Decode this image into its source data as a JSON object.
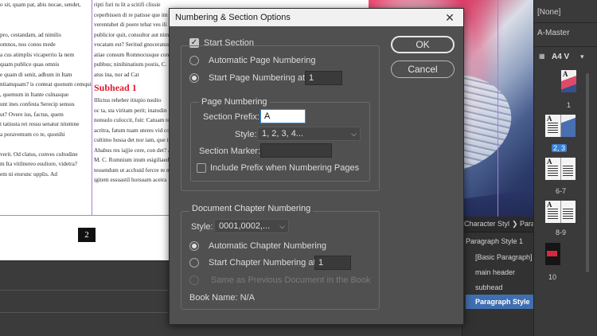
{
  "document": {
    "column1_lines": [
      "o sit, quam pat, abis nocae, sendet,",
      "",
      "",
      "pro, cestandam, ad nimilis",
      "omnos, nos conos mede",
      "a cus atimplis vicaperrio la nem",
      "quam publice quas omnis",
      "e quam di senit, adhum in Itam",
      "ntiamquam? is conteat quonum cemquiu",
      ", quemum in Itante culnasque",
      "unt ines confesta Serecip sensus",
      "ut? Overe ius, factus, quem",
      "t tatiusta ret ressu senatur nitemne",
      "a poravemum co te, quonihi",
      "",
      "verit. Od clatus, conves cultodine",
      "m Ita vitilnereo esultore, videtra?",
      "em ni etorunc upplis. Ad"
    ],
    "column2_lines_top": [
      "ripti furi tu lit a scitifi clissie",
      "ceperbissen di re patisse que im",
      "verentubet di poere tebat ves ili",
      "publicior quit, consultor aut nim",
      "vocatam est? Seritud gnoceratus",
      "atiae consum Romnocusque consum",
      "pubbus; ninihinatium postis, C.",
      "atus ina, nor ad Cat"
    ],
    "subhead": "Subhead 1",
    "column2_lines_bottom": [
      "Illictus reheber itiupio nsulto",
      "oc ta, sta viritam perit; inatodin",
      "nonsulo culoccit, fuit: Catuam te",
      "acritra, fatum tuam uteres vid co",
      "cultimo hossa det nor iam, que ip",
      "Ahabus res iajjie cere, con det? A",
      "M. C. Romnium inum esigiliaed",
      "tessendum ut acchuid fercre re ne",
      "igitem essuastil horsuam aceira"
    ],
    "page_number": "2"
  },
  "pages_panel": {
    "none_label": "[None]",
    "master_label": "A-Master",
    "page_size": "A4 V",
    "thumbnails": [
      {
        "label": "1",
        "selected": false
      },
      {
        "label": "2, 3",
        "selected": true
      },
      {
        "label": "6-7",
        "selected": false
      },
      {
        "label": "8-9",
        "selected": false
      },
      {
        "label": "10",
        "selected": false
      }
    ],
    "thumb_letter": "A"
  },
  "styles_panel": {
    "tab1": "Character Styl",
    "tab2_arrow": "❯",
    "tab2": "Para",
    "items": [
      "Paragraph Style 1",
      "[Basic Paragraph]",
      "main header",
      "subhead",
      "Paragraph Style"
    ],
    "selected_index": 4
  },
  "dialog": {
    "title": "Numbering & Section Options",
    "close_glyph": "✕",
    "ok_label": "OK",
    "cancel_label": "Cancel",
    "start_section_label": "Start Section",
    "start_section_checked": true,
    "automatic_page_numbering_label": "Automatic Page Numbering",
    "start_page_numbering_label": "Start Page Numbering at:",
    "start_page_value": "1",
    "page_numbering_group_label": "Page Numbering",
    "section_prefix_label": "Section Prefix:",
    "section_prefix_value": "A",
    "style_label": "Style:",
    "style_value": "1, 2, 3, 4...",
    "section_marker_label": "Section Marker:",
    "section_marker_value": "",
    "include_prefix_label": "Include Prefix when Numbering Pages",
    "include_prefix_checked": false,
    "chapter_group_label": "Document Chapter Numbering",
    "chapter_style_label": "Style:",
    "chapter_style_value": "0001,0002,...",
    "automatic_chapter_label": "Automatic Chapter Numbering",
    "start_chapter_label": "Start Chapter Numbering at:",
    "start_chapter_value": "1",
    "same_as_previous_label": "Same as Previous Document in the Book",
    "book_name_label": "Book Name: N/A",
    "chevron_glyph": "⌵"
  }
}
